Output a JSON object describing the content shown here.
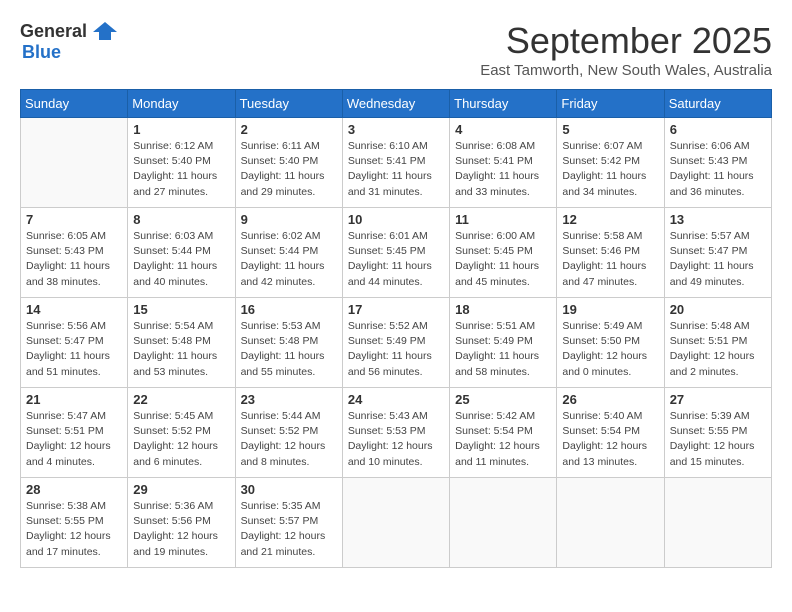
{
  "logo": {
    "general": "General",
    "blue": "Blue"
  },
  "title": "September 2025",
  "subtitle": "East Tamworth, New South Wales, Australia",
  "headers": [
    "Sunday",
    "Monday",
    "Tuesday",
    "Wednesday",
    "Thursday",
    "Friday",
    "Saturday"
  ],
  "weeks": [
    [
      {
        "day": "",
        "sunrise": "",
        "sunset": "",
        "daylight": ""
      },
      {
        "day": "1",
        "sunrise": "Sunrise: 6:12 AM",
        "sunset": "Sunset: 5:40 PM",
        "daylight": "Daylight: 11 hours and 27 minutes."
      },
      {
        "day": "2",
        "sunrise": "Sunrise: 6:11 AM",
        "sunset": "Sunset: 5:40 PM",
        "daylight": "Daylight: 11 hours and 29 minutes."
      },
      {
        "day": "3",
        "sunrise": "Sunrise: 6:10 AM",
        "sunset": "Sunset: 5:41 PM",
        "daylight": "Daylight: 11 hours and 31 minutes."
      },
      {
        "day": "4",
        "sunrise": "Sunrise: 6:08 AM",
        "sunset": "Sunset: 5:41 PM",
        "daylight": "Daylight: 11 hours and 33 minutes."
      },
      {
        "day": "5",
        "sunrise": "Sunrise: 6:07 AM",
        "sunset": "Sunset: 5:42 PM",
        "daylight": "Daylight: 11 hours and 34 minutes."
      },
      {
        "day": "6",
        "sunrise": "Sunrise: 6:06 AM",
        "sunset": "Sunset: 5:43 PM",
        "daylight": "Daylight: 11 hours and 36 minutes."
      }
    ],
    [
      {
        "day": "7",
        "sunrise": "Sunrise: 6:05 AM",
        "sunset": "Sunset: 5:43 PM",
        "daylight": "Daylight: 11 hours and 38 minutes."
      },
      {
        "day": "8",
        "sunrise": "Sunrise: 6:03 AM",
        "sunset": "Sunset: 5:44 PM",
        "daylight": "Daylight: 11 hours and 40 minutes."
      },
      {
        "day": "9",
        "sunrise": "Sunrise: 6:02 AM",
        "sunset": "Sunset: 5:44 PM",
        "daylight": "Daylight: 11 hours and 42 minutes."
      },
      {
        "day": "10",
        "sunrise": "Sunrise: 6:01 AM",
        "sunset": "Sunset: 5:45 PM",
        "daylight": "Daylight: 11 hours and 44 minutes."
      },
      {
        "day": "11",
        "sunrise": "Sunrise: 6:00 AM",
        "sunset": "Sunset: 5:45 PM",
        "daylight": "Daylight: 11 hours and 45 minutes."
      },
      {
        "day": "12",
        "sunrise": "Sunrise: 5:58 AM",
        "sunset": "Sunset: 5:46 PM",
        "daylight": "Daylight: 11 hours and 47 minutes."
      },
      {
        "day": "13",
        "sunrise": "Sunrise: 5:57 AM",
        "sunset": "Sunset: 5:47 PM",
        "daylight": "Daylight: 11 hours and 49 minutes."
      }
    ],
    [
      {
        "day": "14",
        "sunrise": "Sunrise: 5:56 AM",
        "sunset": "Sunset: 5:47 PM",
        "daylight": "Daylight: 11 hours and 51 minutes."
      },
      {
        "day": "15",
        "sunrise": "Sunrise: 5:54 AM",
        "sunset": "Sunset: 5:48 PM",
        "daylight": "Daylight: 11 hours and 53 minutes."
      },
      {
        "day": "16",
        "sunrise": "Sunrise: 5:53 AM",
        "sunset": "Sunset: 5:48 PM",
        "daylight": "Daylight: 11 hours and 55 minutes."
      },
      {
        "day": "17",
        "sunrise": "Sunrise: 5:52 AM",
        "sunset": "Sunset: 5:49 PM",
        "daylight": "Daylight: 11 hours and 56 minutes."
      },
      {
        "day": "18",
        "sunrise": "Sunrise: 5:51 AM",
        "sunset": "Sunset: 5:49 PM",
        "daylight": "Daylight: 11 hours and 58 minutes."
      },
      {
        "day": "19",
        "sunrise": "Sunrise: 5:49 AM",
        "sunset": "Sunset: 5:50 PM",
        "daylight": "Daylight: 12 hours and 0 minutes."
      },
      {
        "day": "20",
        "sunrise": "Sunrise: 5:48 AM",
        "sunset": "Sunset: 5:51 PM",
        "daylight": "Daylight: 12 hours and 2 minutes."
      }
    ],
    [
      {
        "day": "21",
        "sunrise": "Sunrise: 5:47 AM",
        "sunset": "Sunset: 5:51 PM",
        "daylight": "Daylight: 12 hours and 4 minutes."
      },
      {
        "day": "22",
        "sunrise": "Sunrise: 5:45 AM",
        "sunset": "Sunset: 5:52 PM",
        "daylight": "Daylight: 12 hours and 6 minutes."
      },
      {
        "day": "23",
        "sunrise": "Sunrise: 5:44 AM",
        "sunset": "Sunset: 5:52 PM",
        "daylight": "Daylight: 12 hours and 8 minutes."
      },
      {
        "day": "24",
        "sunrise": "Sunrise: 5:43 AM",
        "sunset": "Sunset: 5:53 PM",
        "daylight": "Daylight: 12 hours and 10 minutes."
      },
      {
        "day": "25",
        "sunrise": "Sunrise: 5:42 AM",
        "sunset": "Sunset: 5:54 PM",
        "daylight": "Daylight: 12 hours and 11 minutes."
      },
      {
        "day": "26",
        "sunrise": "Sunrise: 5:40 AM",
        "sunset": "Sunset: 5:54 PM",
        "daylight": "Daylight: 12 hours and 13 minutes."
      },
      {
        "day": "27",
        "sunrise": "Sunrise: 5:39 AM",
        "sunset": "Sunset: 5:55 PM",
        "daylight": "Daylight: 12 hours and 15 minutes."
      }
    ],
    [
      {
        "day": "28",
        "sunrise": "Sunrise: 5:38 AM",
        "sunset": "Sunset: 5:55 PM",
        "daylight": "Daylight: 12 hours and 17 minutes."
      },
      {
        "day": "29",
        "sunrise": "Sunrise: 5:36 AM",
        "sunset": "Sunset: 5:56 PM",
        "daylight": "Daylight: 12 hours and 19 minutes."
      },
      {
        "day": "30",
        "sunrise": "Sunrise: 5:35 AM",
        "sunset": "Sunset: 5:57 PM",
        "daylight": "Daylight: 12 hours and 21 minutes."
      },
      {
        "day": "",
        "sunrise": "",
        "sunset": "",
        "daylight": ""
      },
      {
        "day": "",
        "sunrise": "",
        "sunset": "",
        "daylight": ""
      },
      {
        "day": "",
        "sunrise": "",
        "sunset": "",
        "daylight": ""
      },
      {
        "day": "",
        "sunrise": "",
        "sunset": "",
        "daylight": ""
      }
    ]
  ]
}
